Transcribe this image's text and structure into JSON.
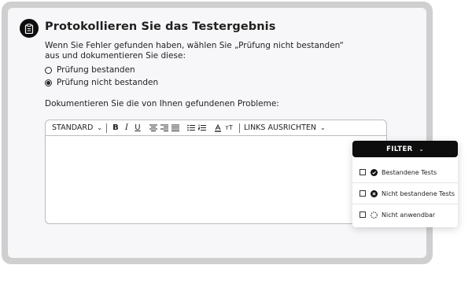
{
  "header": {
    "title": "Protokollieren Sie das Testergebnis",
    "icon": "clipboard-icon"
  },
  "instruction": "Wenn Sie Fehler gefunden haben, wählen Sie „Prüfung nicht bestanden“ aus und dokumentieren Sie diese:",
  "options": [
    {
      "label": "Prüfung bestanden",
      "selected": false
    },
    {
      "label": "Prüfung nicht bestanden",
      "selected": true
    }
  ],
  "section_label": "Dokumentieren Sie die von Ihnen gefundenen Probleme:",
  "toolbar": {
    "style_select": "STANDARD",
    "align_select": "LINKS AUSRICHTEN",
    "buttons": {
      "bold": "B",
      "italic": "I",
      "underline": "U",
      "text_size": "ᴛT"
    }
  },
  "filter": {
    "button_label": "FILTER",
    "items": [
      {
        "label": "Bestandene Tests",
        "icon": "check-circle-icon"
      },
      {
        "label": "Nicht bestandene Tests",
        "icon": "x-circle-icon"
      },
      {
        "label": "Nicht anwendbar",
        "icon": "dashed-circle-icon"
      }
    ]
  },
  "colors": {
    "accent": "#0d0d0d",
    "frame": "#cfcfcf",
    "card": "#f7f7f9"
  }
}
